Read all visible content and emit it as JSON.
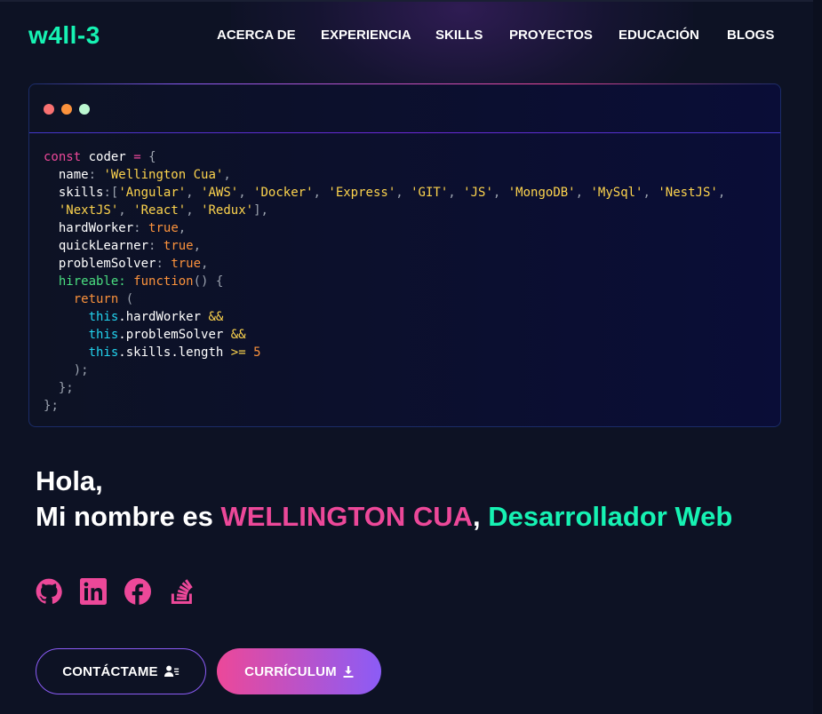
{
  "brand": {
    "logo": "w4ll-3",
    "accent": "#16f2b3",
    "pink": "#ec4899",
    "violet": "#8b5cf6"
  },
  "nav": {
    "items": [
      {
        "label": "ACERCA DE"
      },
      {
        "label": "EXPERIENCIA"
      },
      {
        "label": "SKILLS"
      },
      {
        "label": "PROYECTOS"
      },
      {
        "label": "EDUCACIÓN"
      },
      {
        "label": "BLOGS"
      }
    ]
  },
  "code_window": {
    "dots": [
      "#f87171",
      "#fb923c",
      "#bbf7d0"
    ],
    "lines": [
      "const coder = {",
      "  name: 'Wellington Cua',",
      "  skills:['Angular', 'AWS', 'Docker', 'Express', 'GIT', 'JS', 'MongoDB', 'MySql', 'NestJS',",
      "  'NextJS', 'React', 'Redux'],",
      "  hardWorker: true,",
      "  quickLearner: true,",
      "  problemSolver: true,",
      "  hireable: function() {",
      "    return (",
      "      this.hardWorker &&",
      "      this.problemSolver &&",
      "      this.skills.length >= 5",
      "    );",
      "  };",
      "};"
    ]
  },
  "hero": {
    "greeting": "Hola,",
    "intro": "Mi nombre es ",
    "name": "WELLINGTON CUA",
    "comma": ", ",
    "role": "Desarrollador Web"
  },
  "socials": [
    {
      "icon": "github-icon"
    },
    {
      "icon": "linkedin-icon"
    },
    {
      "icon": "facebook-icon"
    },
    {
      "icon": "stackoverflow-icon"
    }
  ],
  "buttons": {
    "contact_label": "CONTÁCTAME",
    "contact_icon": "user-contact-icon",
    "cv_label": "CURRÍCULUM",
    "cv_icon": "download-icon"
  }
}
